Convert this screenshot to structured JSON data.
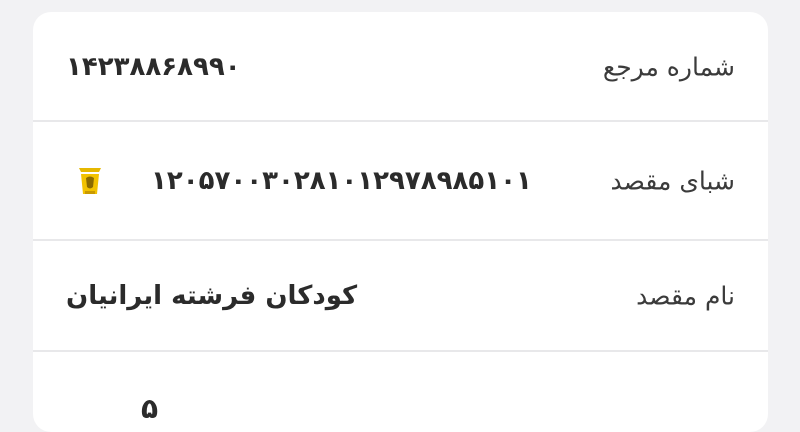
{
  "rows": [
    {
      "label": "شماره مرجع",
      "value": "۱۴۲۳۸۸۶۸۹۹۰"
    },
    {
      "label": "شبای مقصد",
      "value": "۱۲۰۵۷۰۰۳۰۲۸۱۰۱۲۹۷۸۹۸۵۱۰۱",
      "icon": "bank-logo-icon"
    },
    {
      "label": "نام مقصد",
      "value": "کودکان فرشته ایرانیان"
    },
    {
      "label": "",
      "value": "۵"
    }
  ],
  "colors": {
    "background": "#f2f2f4",
    "card": "#ffffff",
    "divider": "#e8e8ea",
    "icon_gold": "#e6b800"
  }
}
